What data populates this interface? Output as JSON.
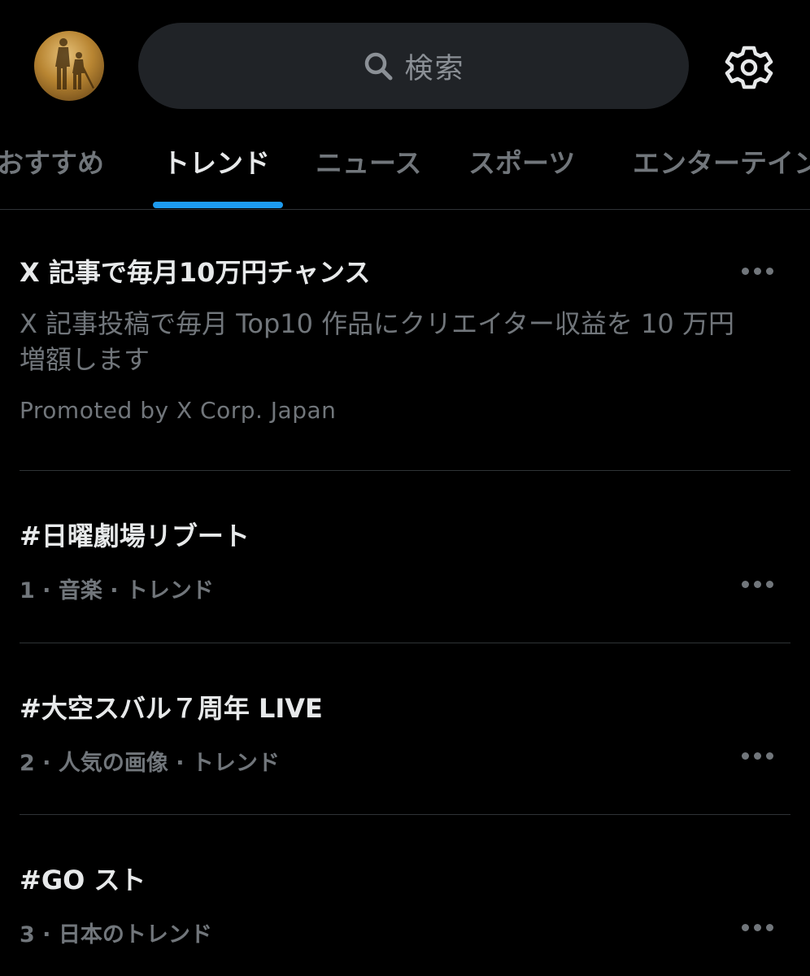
{
  "header": {
    "search_placeholder": "検索"
  },
  "tabs": [
    {
      "label": "おすすめ"
    },
    {
      "label": "トレンド"
    },
    {
      "label": "ニュース"
    },
    {
      "label": "スポーツ"
    },
    {
      "label": "エンターテイン"
    }
  ],
  "active_tab_index": 1,
  "promoted": {
    "title": "X 記事で毎月10万円チャンス",
    "description_line1": "X 記事投稿で毎月 Top10 作品にクリエイター収益を 10 万円",
    "description_line2": "増額します",
    "promoted_by": "Promoted by X Corp. Japan"
  },
  "trends": [
    {
      "title": "#日曜劇場リブート",
      "meta": "1 · 音楽 · トレンド"
    },
    {
      "title": "#大空スバル７周年 LIVE",
      "meta": "2 · 人気の画像 · トレンド"
    },
    {
      "title": "#GO スト",
      "meta": "3 · 日本のトレンド"
    }
  ],
  "icons": {
    "search": "search-icon",
    "settings": "gear-icon",
    "more": "more-options-icon"
  },
  "colors": {
    "background": "#000000",
    "accent": "#1d9bf0",
    "primary_text": "#e7e9ea",
    "secondary_text": "#71767b"
  }
}
